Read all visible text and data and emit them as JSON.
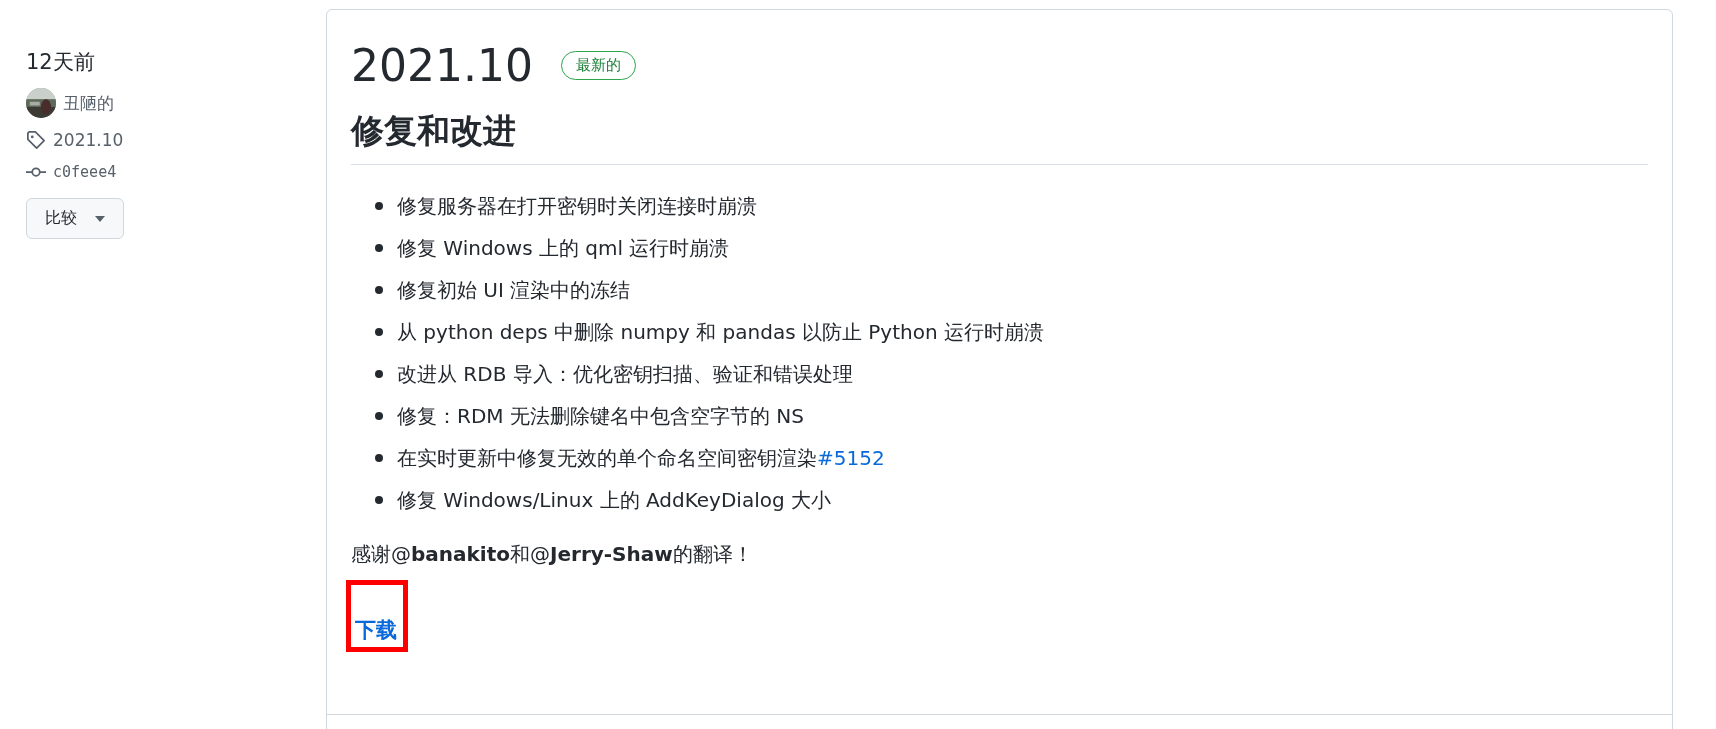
{
  "sidebar": {
    "time": "12天前",
    "author": "丑陋的",
    "tag": "2021.10",
    "commit": "c0feee4",
    "compare_button": "比较"
  },
  "release": {
    "title": "2021.10",
    "badge": "最新的",
    "heading": "修复和改进",
    "items": [
      {
        "text": "修复服务器在打开密钥时关闭连接时崩溃"
      },
      {
        "text": "修复 Windows 上的 qml 运行时崩溃"
      },
      {
        "text": "修复初始 UI 渲染中的冻结"
      },
      {
        "text": "从 python deps 中删除 numpy 和 pandas 以防止 Python 运行时崩溃"
      },
      {
        "text": "改进从 RDB 导入：优化密钥扫描、验证和错误处理"
      },
      {
        "text": "修复：RDM 无法删除键名中包含空字节的 NS"
      },
      {
        "text": "在实时更新中修复无效的单个命名空间密钥渲染",
        "link": "#5152"
      },
      {
        "text": "修复 Windows/Linux 上的 AddKeyDialog 大小"
      }
    ],
    "thanks": "感谢@**banakito**和@**Jerry-Shaw**的翻译！",
    "download": "下载"
  }
}
